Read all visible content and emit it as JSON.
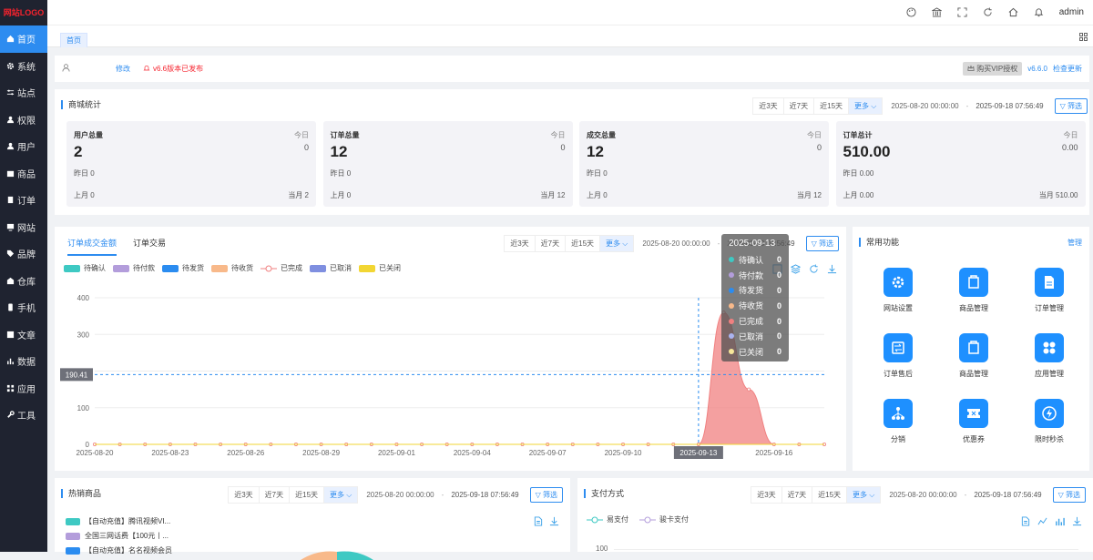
{
  "logo": "网站LOGO",
  "nav": [
    {
      "label": "首页",
      "icon": "home-icon"
    },
    {
      "label": "系统",
      "icon": "gear-icon"
    },
    {
      "label": "站点",
      "icon": "sliders-icon"
    },
    {
      "label": "权限",
      "icon": "user-shield-icon"
    },
    {
      "label": "用户",
      "icon": "user-icon"
    },
    {
      "label": "商品",
      "icon": "product-icon"
    },
    {
      "label": "订单",
      "icon": "order-icon"
    },
    {
      "label": "网站",
      "icon": "monitor-icon"
    },
    {
      "label": "品牌",
      "icon": "tag-icon"
    },
    {
      "label": "仓库",
      "icon": "warehouse-icon"
    },
    {
      "label": "手机",
      "icon": "phone-icon"
    },
    {
      "label": "文章",
      "icon": "article-icon"
    },
    {
      "label": "数据",
      "icon": "bar-chart-icon"
    },
    {
      "label": "应用",
      "icon": "apps-icon"
    },
    {
      "label": "工具",
      "icon": "wrench-icon"
    }
  ],
  "topbar": {
    "user": "admin"
  },
  "tabs": {
    "home": "首页"
  },
  "info": {
    "edit": "修改",
    "version_notice": "v6.6版本已发布",
    "vip": "购买VIP授权",
    "version": "v6.6.0",
    "update": "检查更新"
  },
  "filters": {
    "d3": "近3天",
    "d7": "近7天",
    "d15": "近15天",
    "more": "更多",
    "start": "2025-08-20 00:00:00",
    "sep": "-",
    "end": "2025-09-18 07:56:49",
    "filter": "筛选"
  },
  "mall": {
    "title": "商城统计",
    "stats": [
      {
        "label": "用户总量",
        "today_label": "今日",
        "value": "2",
        "today": "0",
        "yesterday": "昨日  0",
        "last_month": "上月   0",
        "this_month": "当月   2"
      },
      {
        "label": "订单总量",
        "today_label": "今日",
        "value": "12",
        "today": "0",
        "yesterday": "昨日 0",
        "last_month": "上月   0",
        "this_month": "当月   12"
      },
      {
        "label": "成交总量",
        "today_label": "今日",
        "value": "12",
        "today": "0",
        "yesterday": "昨日 0",
        "last_month": "上月   0",
        "this_month": "当月   12"
      },
      {
        "label": "订单总计",
        "today_label": "今日",
        "value": "510.00",
        "today": "0.00",
        "yesterday": "昨日 0.00",
        "last_month": "上月   0.00",
        "this_month": "当月   510.00"
      }
    ]
  },
  "order_chart": {
    "tab1": "订单成交金额",
    "tab2": "订单交易"
  },
  "chart_data": {
    "type": "area",
    "x": [
      "2025-08-20",
      "2025-08-21",
      "2025-08-22",
      "2025-08-23",
      "2025-08-24",
      "2025-08-25",
      "2025-08-26",
      "2025-08-27",
      "2025-08-28",
      "2025-08-29",
      "2025-08-30",
      "2025-08-31",
      "2025-09-01",
      "2025-09-02",
      "2025-09-03",
      "2025-09-04",
      "2025-09-05",
      "2025-09-06",
      "2025-09-07",
      "2025-09-08",
      "2025-09-09",
      "2025-09-10",
      "2025-09-11",
      "2025-09-12",
      "2025-09-13",
      "2025-09-14",
      "2025-09-15",
      "2025-09-16",
      "2025-09-17",
      "2025-09-18"
    ],
    "x_ticks": [
      "2025-08-20",
      "2025-08-23",
      "2025-08-26",
      "2025-08-29",
      "2025-09-01",
      "2025-09-04",
      "2025-09-07",
      "2025-09-10",
      "2025-09-13",
      "2025-09-16"
    ],
    "y_ticks": [
      0,
      100,
      200,
      300,
      400
    ],
    "ylim": [
      0,
      400
    ],
    "series": [
      {
        "name": "待确认",
        "color": "#3ec9c3",
        "values": [
          0,
          0,
          0,
          0,
          0,
          0,
          0,
          0,
          0,
          0,
          0,
          0,
          0,
          0,
          0,
          0,
          0,
          0,
          0,
          0,
          0,
          0,
          0,
          0,
          0,
          0,
          0,
          0,
          0,
          0
        ]
      },
      {
        "name": "待付款",
        "color": "#b39ddb",
        "values": [
          0,
          0,
          0,
          0,
          0,
          0,
          0,
          0,
          0,
          0,
          0,
          0,
          0,
          0,
          0,
          0,
          0,
          0,
          0,
          0,
          0,
          0,
          0,
          0,
          0,
          0,
          0,
          0,
          0,
          0
        ]
      },
      {
        "name": "待发货",
        "color": "#2b8cf0",
        "values": [
          0,
          0,
          0,
          0,
          0,
          0,
          0,
          0,
          0,
          0,
          0,
          0,
          0,
          0,
          0,
          0,
          0,
          0,
          0,
          0,
          0,
          0,
          0,
          0,
          0,
          0,
          0,
          0,
          0,
          0
        ]
      },
      {
        "name": "待收货",
        "color": "#f8b98a",
        "values": [
          0,
          0,
          0,
          0,
          0,
          0,
          0,
          0,
          0,
          0,
          0,
          0,
          0,
          0,
          0,
          0,
          0,
          0,
          0,
          0,
          0,
          0,
          0,
          0,
          0,
          0,
          0,
          0,
          0,
          0
        ]
      },
      {
        "name": "已完成",
        "color": "#f08080",
        "values": [
          0,
          0,
          0,
          0,
          0,
          0,
          0,
          0,
          0,
          0,
          0,
          0,
          0,
          0,
          0,
          0,
          0,
          0,
          0,
          0,
          0,
          0,
          0,
          0,
          0,
          360,
          150,
          0,
          0,
          0
        ]
      },
      {
        "name": "已取消",
        "color": "#7f8fe0",
        "values": [
          0,
          0,
          0,
          0,
          0,
          0,
          0,
          0,
          0,
          0,
          0,
          0,
          0,
          0,
          0,
          0,
          0,
          0,
          0,
          0,
          0,
          0,
          0,
          0,
          0,
          0,
          0,
          0,
          0,
          0
        ]
      },
      {
        "name": "已关闭",
        "color": "#f2d633",
        "values": [
          0,
          0,
          0,
          0,
          0,
          0,
          0,
          0,
          0,
          0,
          0,
          0,
          0,
          0,
          0,
          0,
          0,
          0,
          0,
          0,
          0,
          0,
          0,
          0,
          0,
          0,
          0,
          0,
          0,
          0
        ]
      }
    ],
    "crosshair_x": "2025-09-13",
    "crosshair_y": 190.41,
    "crosshair_y_label": "190.41",
    "tooltip": {
      "title": "2025-09-13",
      "rows": [
        {
          "name": "待确认",
          "value": "0",
          "color": "#3ec9c3"
        },
        {
          "name": "待付款",
          "value": "0",
          "color": "#b39ddb"
        },
        {
          "name": "待发货",
          "value": "0",
          "color": "#2b8cf0"
        },
        {
          "name": "待收货",
          "value": "0",
          "color": "#f8b98a"
        },
        {
          "name": "已完成",
          "value": "0",
          "color": "#f08080"
        },
        {
          "name": "已取消",
          "value": "0",
          "color": "#aab4f0"
        },
        {
          "name": "已关闭",
          "value": "0",
          "color": "#f7e79a"
        }
      ]
    }
  },
  "functions": {
    "title": "常用功能",
    "manage": "管理",
    "items": [
      {
        "label": "网站设置",
        "icon": "settings-icon"
      },
      {
        "label": "商品管理",
        "icon": "goods-icon"
      },
      {
        "label": "订单管理",
        "icon": "document-icon"
      },
      {
        "label": "订单售后",
        "icon": "exchange-icon"
      },
      {
        "label": "商品管理",
        "icon": "goods-icon"
      },
      {
        "label": "应用管理",
        "icon": "apps-icon"
      },
      {
        "label": "分销",
        "icon": "network-icon"
      },
      {
        "label": "优惠券",
        "icon": "coupon-icon"
      },
      {
        "label": "限时秒杀",
        "icon": "lightning-icon"
      }
    ]
  },
  "hot": {
    "title": "热销商品",
    "items": [
      {
        "label": "【自动充值】腾讯视频VI...",
        "color": "#3ec9c3"
      },
      {
        "label": "全国三网话费【100元丨...",
        "color": "#b39ddb"
      },
      {
        "label": "【自动充值】名名视频会员",
        "color": "#2b8cf0"
      }
    ]
  },
  "pay": {
    "title": "支付方式",
    "legend": [
      {
        "label": "易支付",
        "color": "#3ec9c3"
      },
      {
        "label": "骏卡支付",
        "color": "#b39ddb"
      }
    ],
    "y_top": "100"
  }
}
